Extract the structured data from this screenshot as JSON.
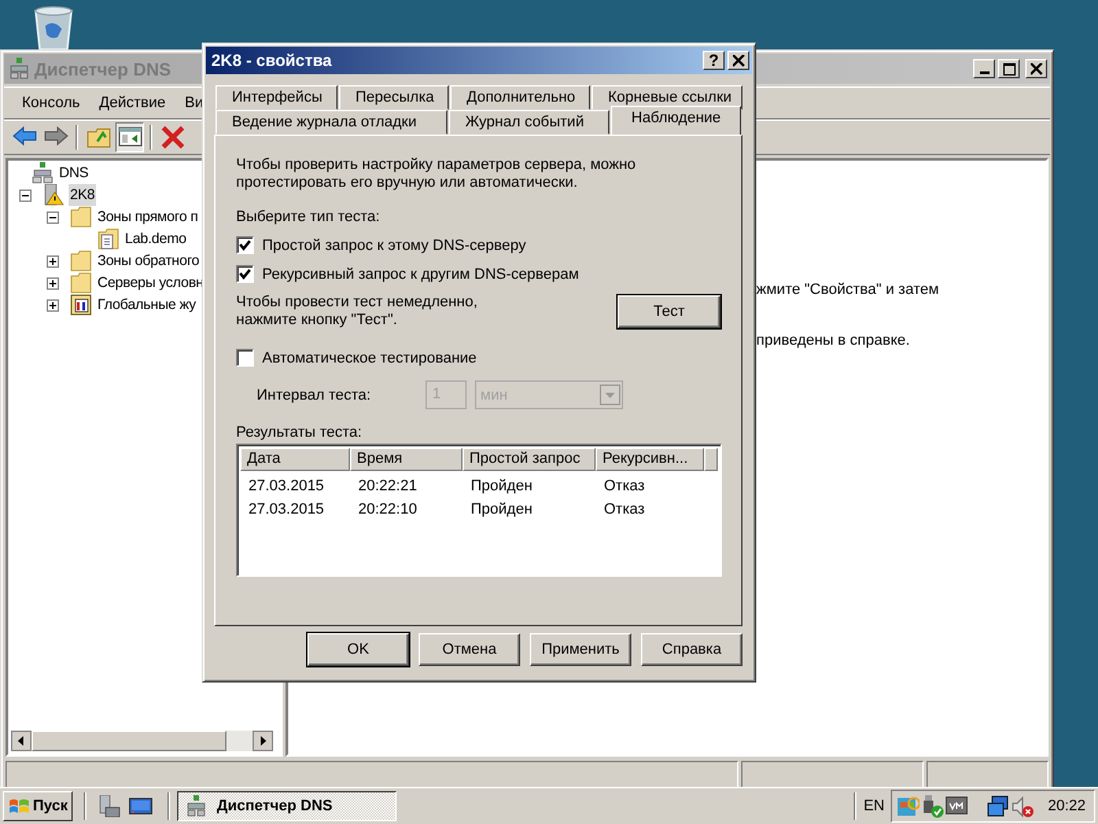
{
  "main_window": {
    "title": "Диспетчер DNS",
    "active": false,
    "menu": [
      "Консоль",
      "Действие",
      "Ви"
    ],
    "toolbar": [
      {
        "kind": "back",
        "pressed": false
      },
      {
        "kind": "forward",
        "pressed": false
      },
      {
        "kind": "sep"
      },
      {
        "kind": "up",
        "pressed": false
      },
      {
        "kind": "tree",
        "pressed": true
      },
      {
        "kind": "sep"
      },
      {
        "kind": "delete",
        "pressed": false
      }
    ],
    "tree": [
      {
        "label": "DNS",
        "kind": "root",
        "selected": false,
        "children": [
          {
            "label": "2K8",
            "kind": "server",
            "selected": true,
            "expanded": true,
            "children": [
              {
                "label": "Зоны прямого п",
                "kind": "folder",
                "selected": false,
                "expanded": true,
                "children": [
                  {
                    "label": "Lab.demo",
                    "kind": "zone",
                    "selected": false
                  }
                ]
              },
              {
                "label": "Зоны обратного",
                "kind": "folder",
                "selected": false,
                "expanded": false
              },
              {
                "label": "Серверы условн",
                "kind": "folder",
                "selected": false,
                "expanded": false
              },
              {
                "label": "Глобальные жу",
                "kind": "log",
                "selected": false,
                "expanded": false
              }
            ]
          }
        ]
      }
    ],
    "detail_lines": [
      "жмите \"Свойства\" и затем",
      "приведены в справке."
    ]
  },
  "dialog": {
    "title": "2K8 - свойства",
    "active": true,
    "help_glyph": "?",
    "tab_rows": [
      [
        {
          "label": "Интерфейсы",
          "selected": false
        },
        {
          "label": "Пересылка",
          "selected": false
        },
        {
          "label": "Дополнительно",
          "selected": false
        },
        {
          "label": "Корневые ссылки",
          "selected": false
        }
      ],
      [
        {
          "label": "Ведение журнала отладки",
          "selected": false
        },
        {
          "label": "Журнал событий",
          "selected": false
        },
        {
          "label": "Наблюдение",
          "selected": true
        }
      ]
    ],
    "intro": "Чтобы проверить настройку параметров сервера, можно протестировать его вручную или автоматически.",
    "test_type_label": "Выберите тип теста:",
    "checks": [
      {
        "label": "Простой запрос к этому DNS-серверу",
        "checked": true
      },
      {
        "label": "Рекурсивный запрос к другим DNS-серверам",
        "checked": true
      }
    ],
    "test_now_text": "Чтобы провести тест немедленно, нажмите кнопку \"Тест\".",
    "test_button": "Тест",
    "auto": {
      "label": "Автоматическое тестирование",
      "checked": false
    },
    "interval": {
      "label": "Интервал теста:",
      "value": "1",
      "unit": "мин",
      "disabled": true
    },
    "results": {
      "label": "Результаты теста:",
      "columns": [
        "Дата",
        "Время",
        "Простой запрос",
        "Рекурсивн..."
      ],
      "rows": [
        [
          "27.03.2015",
          "20:22:21",
          "Пройден",
          "Отказ"
        ],
        [
          "27.03.2015",
          "20:22:10",
          "Пройден",
          "Отказ"
        ]
      ]
    },
    "buttons": [
      {
        "label": "OK",
        "default": true
      },
      {
        "label": "Отмена",
        "default": false
      },
      {
        "label": "Применить",
        "default": false
      },
      {
        "label": "Справка",
        "default": false
      }
    ]
  },
  "taskbar": {
    "start": "Пуск",
    "quick_launch": [
      {
        "kind": "server-manager"
      },
      {
        "kind": "desktop"
      }
    ],
    "tasks": [
      {
        "label": "Диспетчер DNS",
        "selected": true
      }
    ],
    "language": "EN",
    "clock": "20:22"
  }
}
